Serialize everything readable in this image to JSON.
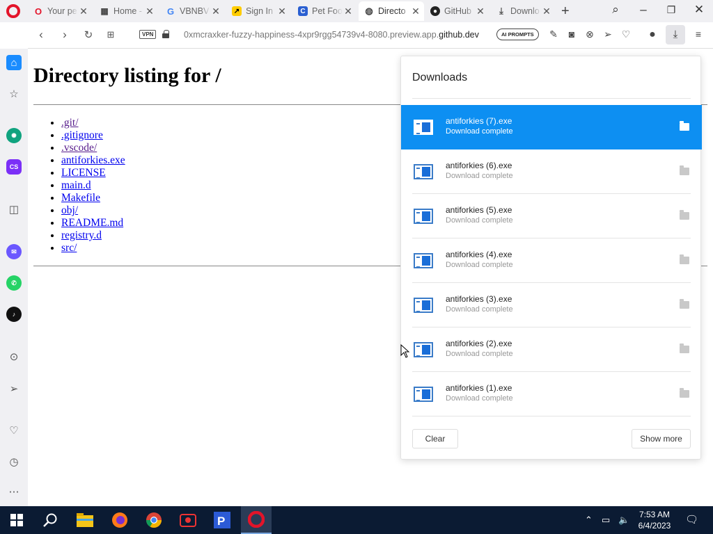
{
  "browser": {
    "tabs": [
      {
        "title": "Your pe",
        "icon": "opera-o-icon"
      },
      {
        "title": "Home -",
        "icon": "film-icon"
      },
      {
        "title": "VBNBVI",
        "icon": "google-icon"
      },
      {
        "title": "Sign In",
        "icon": "arrow-icon"
      },
      {
        "title": "Pet Foo",
        "icon": "c-icon"
      },
      {
        "title": "Directo",
        "icon": "globe-icon",
        "active": true
      },
      {
        "title": "GitHub",
        "icon": "github-icon"
      },
      {
        "title": "Downlo",
        "icon": "download-icon"
      }
    ],
    "vpn_label": "VPN",
    "url_prefix": "0xmcraxker-fuzzy-happiness-4xpr9rgg54739v4-8080.preview.app.",
    "url_domain": "github.dev",
    "ai_prompts_label": "AI PROMPTS"
  },
  "page": {
    "heading": "Directory listing for /",
    "entries": [
      ".git/",
      ".gitignore",
      ".vscode/",
      "antiforkies.exe",
      "LICENSE",
      "main.d",
      "Makefile",
      "obj/",
      "README.md",
      "registry.d",
      "src/"
    ]
  },
  "downloads": {
    "title": "Downloads",
    "items": [
      {
        "name": "antiforkies (7).exe",
        "status": "Download complete",
        "selected": true
      },
      {
        "name": "antiforkies (6).exe",
        "status": "Download complete"
      },
      {
        "name": "antiforkies (5).exe",
        "status": "Download complete"
      },
      {
        "name": "antiforkies (4).exe",
        "status": "Download complete"
      },
      {
        "name": "antiforkies (3).exe",
        "status": "Download complete"
      },
      {
        "name": "antiforkies (2).exe",
        "status": "Download complete"
      },
      {
        "name": "antiforkies (1).exe",
        "status": "Download complete"
      }
    ],
    "clear_label": "Clear",
    "show_more_label": "Show more"
  },
  "taskbar": {
    "time": "7:53 AM",
    "date": "6/4/2023"
  },
  "colors": {
    "accent": "#0d8ff2",
    "opera_red": "#e3142a",
    "taskbar": "#0b1b33"
  }
}
